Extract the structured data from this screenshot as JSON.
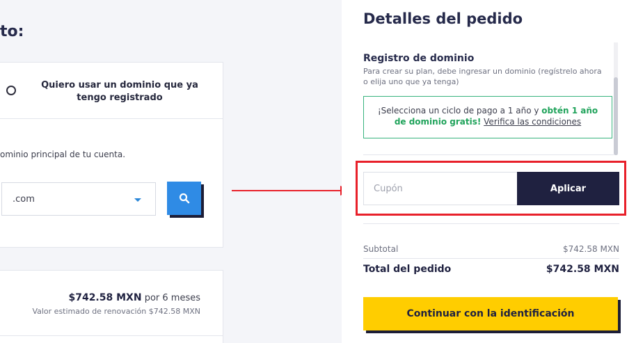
{
  "left": {
    "heading": "to:",
    "option_label": "Quiero usar un dominio que ya tengo registrado",
    "hint": "ominio principal de tu cuenta.",
    "tld_value": ".com",
    "price_value": "$742.58 MXN",
    "price_period": "por 6 meses",
    "renewal": "Valor estimado de renovación $742.58 MXN"
  },
  "order": {
    "title": "Detalles del pedido",
    "registration_title": "Registro de dominio",
    "registration_desc": "Para crear su plan, debe ingresar un dominio (regístrelo ahora o elija uno que ya tenga)",
    "promo_text": "¡Selecciona un ciclo de pago a 1 año y ",
    "promo_highlight": "obtén 1 año de dominio gratis!",
    "promo_link": "Verifica las condiciones",
    "coupon_placeholder": "Cupón",
    "apply_label": "Aplicar",
    "subtotal_label": "Subtotal",
    "subtotal_value": "$742.58 MXN",
    "total_label": "Total del pedido",
    "total_value": "$742.58 MXN",
    "continue_label": "Continuar con la identificación"
  },
  "icons": {
    "search": "search-icon",
    "arrow": "arrow-right-icon"
  },
  "colors": {
    "accent_blue": "#2f8be5",
    "dark_navy": "#1f2140",
    "yellow": "#ffcd00",
    "promo_green": "#20a35b",
    "highlight_red": "#e8202a"
  }
}
